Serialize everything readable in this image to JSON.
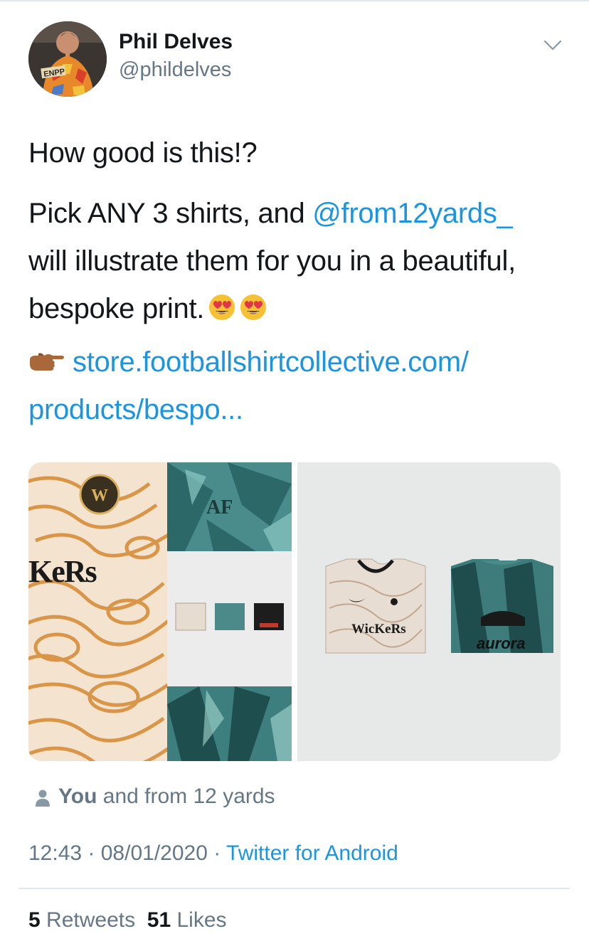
{
  "tweet": {
    "author": {
      "display_name": "Phil Delves",
      "handle": "@phildelves",
      "avatar_badge_text": "ENPP"
    },
    "text": {
      "line1": "How good is this!?",
      "part1": "Pick ANY 3 shirts, and ",
      "mention": "@from12yards_",
      "part2": " will illustrate them for you in a beautiful, bespoke print."
    },
    "emojis": [
      "heart-eyes-emoji",
      "heart-eyes-emoji",
      "pointing-right-emoji"
    ],
    "link": {
      "line1": "store.footballshirtcollective.com/",
      "line2": "products/bespo..."
    },
    "media": {
      "left_image_text": "KeRs",
      "right_image_text_1": "WicKeRs",
      "right_image_text_2": "aurora"
    },
    "social_context": {
      "bold": "You",
      "rest": " and from 12 yards"
    },
    "meta": {
      "time": "12:43",
      "separator": " · ",
      "date": "08/01/2020",
      "source": "Twitter for Android"
    },
    "stats": {
      "retweets_count": "5",
      "retweets_label": "Retweets",
      "likes_count": "51",
      "likes_label": "Likes"
    }
  },
  "colors": {
    "link": "#1b95e0",
    "secondary_text": "#657786",
    "primary_text": "#14171a",
    "divider": "#e1e8ed"
  }
}
